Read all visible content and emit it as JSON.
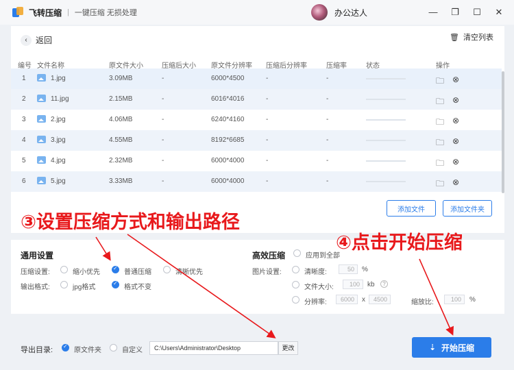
{
  "titlebar": {
    "app_name": "飞转压缩",
    "separator": "|",
    "slogan": "一键压缩 无损处理",
    "user_name": "办公达人",
    "minimize": "—",
    "restore": "❐",
    "maximize": "☐",
    "close": "✕"
  },
  "list": {
    "back_label": "返回",
    "back_icon": "chevron-left",
    "clear_label": "清空列表",
    "clear_icon": "trash",
    "columns": [
      "编号",
      "文件名称",
      "原文件大小",
      "压缩后大小",
      "原文件分辨率",
      "压缩后分辨率",
      "压缩率",
      "状态",
      "操作"
    ],
    "rows": [
      {
        "no": "1",
        "name": "1.jpg",
        "size": "3.09MB",
        "csize": "-",
        "res": "6000*4500",
        "cres": "-",
        "rate": "-"
      },
      {
        "no": "2",
        "name": "11.jpg",
        "size": "2.15MB",
        "csize": "-",
        "res": "6016*4016",
        "cres": "-",
        "rate": "-"
      },
      {
        "no": "3",
        "name": "2.jpg",
        "size": "4.06MB",
        "csize": "-",
        "res": "6240*4160",
        "cres": "-",
        "rate": "-"
      },
      {
        "no": "4",
        "name": "3.jpg",
        "size": "4.55MB",
        "csize": "-",
        "res": "8192*6685",
        "cres": "-",
        "rate": "-"
      },
      {
        "no": "5",
        "name": "4.jpg",
        "size": "2.32MB",
        "csize": "-",
        "res": "6000*4000",
        "cres": "-",
        "rate": "-"
      },
      {
        "no": "6",
        "name": "5.jpg",
        "size": "3.33MB",
        "csize": "-",
        "res": "6000*4000",
        "cres": "-",
        "rate": "-"
      }
    ],
    "folder_icon": "🗀",
    "remove_icon": "⊗",
    "add_file": "添加文件",
    "add_folder": "添加文件夹"
  },
  "settings": {
    "general_title": "通用设置",
    "mode_label": "压缩设置:",
    "mode_options": [
      "缩小优先",
      "普通压缩",
      "清晰优先"
    ],
    "mode_selected": "普通压缩",
    "format_label": "输出格式:",
    "format_options": [
      "jpg格式",
      "格式不变"
    ],
    "format_selected": "格式不变",
    "efficient_title": "高效压缩",
    "apply_all": "应用到全部",
    "image_label": "图片设置:",
    "clarity_label": "清晰度:",
    "clarity_value": "50",
    "clarity_unit": "%",
    "filesize_label": "文件大小:",
    "filesize_value": "100",
    "filesize_unit": "kb",
    "help_icon": "?",
    "resolution_label": "分辨率:",
    "res_w": "6000",
    "res_x": "x",
    "res_h": "4500",
    "scale_label": "缩放比:",
    "scale_value": "100",
    "scale_unit": "%"
  },
  "footer": {
    "export_label": "导出目录:",
    "option_original": "原文件夹",
    "option_custom": "自定义",
    "selected": "原文件夹",
    "path": "C:\\Users\\Administrator\\Desktop",
    "change": "更改",
    "start": "开始压缩",
    "start_icon": "⇣"
  },
  "annotations": {
    "step3": "③设置压缩方式和输出路径",
    "step4": "④点击开始压缩",
    "color": "#e8191c"
  }
}
